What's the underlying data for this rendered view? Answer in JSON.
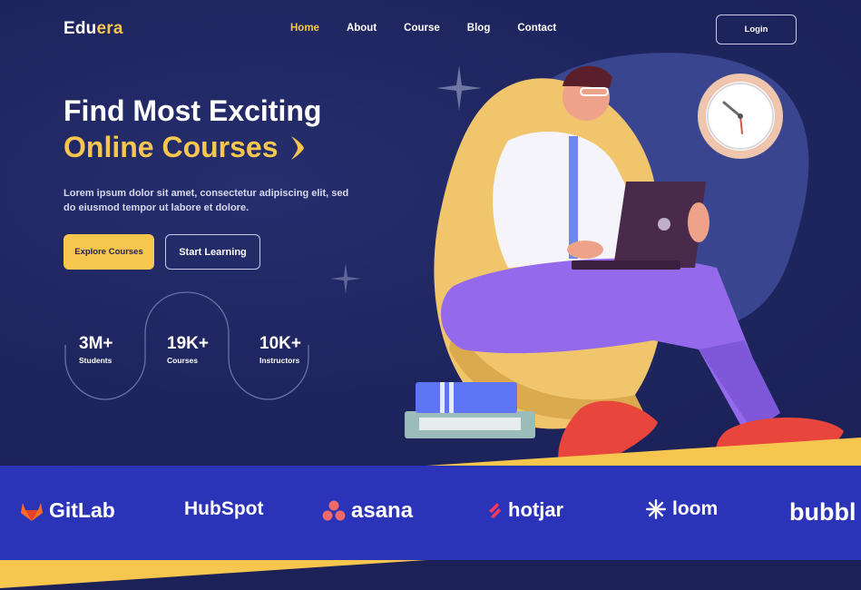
{
  "brand": {
    "logo_part1": "Edu",
    "logo_part2": "era"
  },
  "nav": {
    "items": [
      {
        "label": "Home",
        "active": true
      },
      {
        "label": "About"
      },
      {
        "label": "Course"
      },
      {
        "label": "Blog"
      },
      {
        "label": "Contact"
      }
    ],
    "login_label": "Login"
  },
  "hero": {
    "title_line1": "Find Most Exciting",
    "title_line2": "Online Courses",
    "description": "Lorem ipsum dolor sit amet, consectetur adipiscing elit, sed do eiusmod tempor ut labore et dolore.",
    "explore_label": "Explore Courses",
    "learn_label": "Start Learning"
  },
  "stats": [
    {
      "value": "3M+",
      "label": "Students"
    },
    {
      "value": "19K+",
      "label": "Courses"
    },
    {
      "value": "10K+",
      "label": "Instructors"
    }
  ],
  "partners": [
    {
      "name": "GitLab",
      "icon": "gitlab-icon"
    },
    {
      "name": "HubSpot",
      "icon": "hubspot-icon"
    },
    {
      "name": "asana",
      "icon": "asana-icon"
    },
    {
      "name": "hotjar",
      "icon": "hotjar-icon"
    },
    {
      "name": "loom",
      "icon": "loom-icon"
    },
    {
      "name": "bubbl",
      "icon": "bubble-icon"
    }
  ],
  "colors": {
    "accent": "#f7c64e",
    "background": "#1c2257",
    "strip": "#2b34b8",
    "purple": "#9469ec"
  }
}
